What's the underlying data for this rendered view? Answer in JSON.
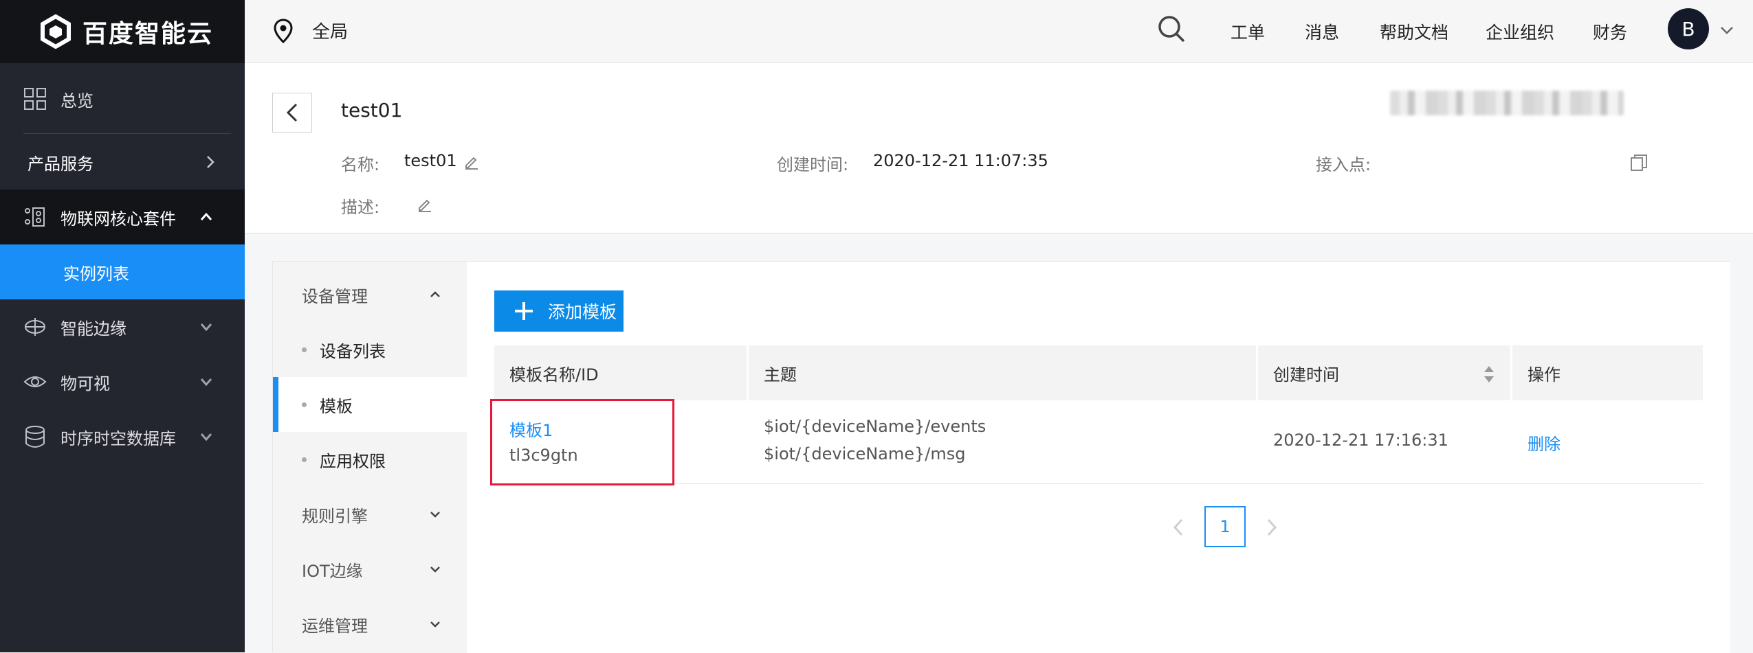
{
  "brand": {
    "name": "百度智能云"
  },
  "sidebar": {
    "items": [
      {
        "label": "总览",
        "icon": "grid-icon"
      },
      {
        "label": "产品服务",
        "icon": "chevron-right-icon"
      },
      {
        "label": "物联网核心套件",
        "icon": "iot-core-icon"
      },
      {
        "label": "实例列表"
      },
      {
        "label": "智能边缘",
        "icon": "edge-icon"
      },
      {
        "label": "物可视",
        "icon": "eye-icon"
      },
      {
        "label": "时序时空数据库",
        "icon": "database-icon"
      }
    ]
  },
  "topbar": {
    "region": "全局",
    "menu": [
      "工单",
      "消息",
      "帮助文档",
      "企业组织",
      "财务"
    ],
    "avatar_letter": "B"
  },
  "instance": {
    "title": "test01",
    "name_label": "名称:",
    "name_value": "test01",
    "created_label": "创建时间:",
    "created_value": "2020-12-21 11:07:35",
    "endpoint_label": "接入点:",
    "desc_label": "描述:"
  },
  "subnav": {
    "items": [
      {
        "label": "设备管理",
        "type": "group",
        "expanded": true
      },
      {
        "label": "设备列表",
        "type": "child"
      },
      {
        "label": "模板",
        "type": "child",
        "active": true
      },
      {
        "label": "应用权限",
        "type": "child"
      },
      {
        "label": "规则引擎",
        "type": "group"
      },
      {
        "label": "IOT边缘",
        "type": "group"
      },
      {
        "label": "运维管理",
        "type": "group"
      }
    ]
  },
  "content": {
    "add_button": "添加模板",
    "table": {
      "columns": [
        "模板名称/ID",
        "主题",
        "创建时间",
        "操作"
      ],
      "rows": [
        {
          "name": "模板1",
          "id": "tl3c9gtn",
          "topics": [
            "$iot/{deviceName}/events",
            "$iot/{deviceName}/msg"
          ],
          "created": "2020-12-21 17:16:31",
          "action": "删除"
        }
      ]
    },
    "pagination": {
      "current_page": "1"
    }
  },
  "colors": {
    "accent": "#1a8ef7",
    "sidebar_bg": "#23252f",
    "highlight": "#e6193a",
    "add_button_bg": "#0b8ae8"
  }
}
